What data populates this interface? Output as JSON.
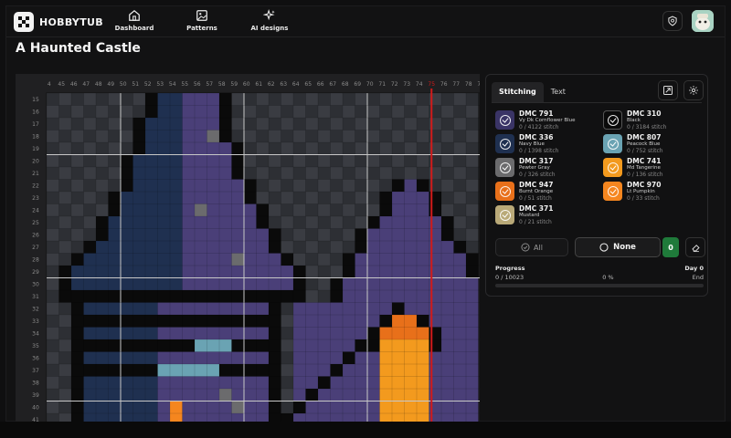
{
  "app": {
    "brand": "HOBBYTUB"
  },
  "nav": [
    {
      "label": "Dashboard",
      "icon": "home-icon"
    },
    {
      "label": "Patterns",
      "icon": "image-icon"
    },
    {
      "label": "AI designs",
      "icon": "sparkles-icon"
    }
  ],
  "page": {
    "title": "A Haunted Castle"
  },
  "ruler": {
    "columns": [
      "4",
      "45",
      "46",
      "47",
      "48",
      "49",
      "50",
      "51",
      "52",
      "53",
      "54",
      "55",
      "56",
      "57",
      "58",
      "59",
      "60",
      "61",
      "62",
      "63",
      "64",
      "65",
      "66",
      "67",
      "68",
      "69",
      "70",
      "71",
      "72",
      "73",
      "74",
      "75",
      "76",
      "77",
      "78",
      "79"
    ],
    "rows": [
      "15",
      "16",
      "17",
      "18",
      "19",
      "20",
      "21",
      "22",
      "23",
      "24",
      "25",
      "26",
      "27",
      "28",
      "29",
      "30",
      "31",
      "32",
      "33",
      "34",
      "35",
      "36",
      "37",
      "38",
      "39",
      "40",
      "41"
    ],
    "highlight_column": "75"
  },
  "panel": {
    "tabs": [
      {
        "label": "Stitching",
        "active": true
      },
      {
        "label": "Text",
        "active": false
      }
    ],
    "threads": [
      {
        "code": "DMC 791",
        "name": "Vy Dk Cornflower Blue",
        "count": "0 / 4122 stitch",
        "color": "#3a3466"
      },
      {
        "code": "DMC 310",
        "name": "Black",
        "count": "0 / 3184 stitch",
        "color": "#0a0a0a"
      },
      {
        "code": "DMC 336",
        "name": "Navy Blue",
        "count": "0 / 1398 stitch",
        "color": "#1f3050"
      },
      {
        "code": "DMC 807",
        "name": "Peacock Blue",
        "count": "0 / 752 stitch",
        "color": "#6aa3b3"
      },
      {
        "code": "DMC 317",
        "name": "Pewter Gray",
        "count": "0 / 326 stitch",
        "color": "#6b6b6d"
      },
      {
        "code": "DMC 741",
        "name": "Md Tangerine",
        "count": "0 / 136 stitch",
        "color": "#f39a1e"
      },
      {
        "code": "DMC 947",
        "name": "Burnt Orange",
        "count": "0 / 51 stitch",
        "color": "#e8701a"
      },
      {
        "code": "DMC 970",
        "name": "Lt Pumpkin",
        "count": "0 / 33 stitch",
        "color": "#f5861f"
      },
      {
        "code": "DMC 371",
        "name": "Mustard",
        "count": "0 / 21 stitch",
        "color": "#b9a978"
      }
    ],
    "buttons": {
      "all": "All",
      "none": "None",
      "selected_count": "0"
    },
    "progress": {
      "label": "Progress",
      "day": "Day 0",
      "stitches": "0 / 10023",
      "percent_text": "0 %",
      "end": "End",
      "fraction": 0
    }
  },
  "colors": {
    "purple": "#4a3f78",
    "navy": "#1f3050",
    "black": "#0a0a0a",
    "peacock": "#6aa3b3",
    "pewter": "#6b6b6d",
    "tangerine": "#f39a1e",
    "burnt": "#e8701a",
    "pumpkin": "#f5861f",
    "highlight": "#d11a1a"
  }
}
